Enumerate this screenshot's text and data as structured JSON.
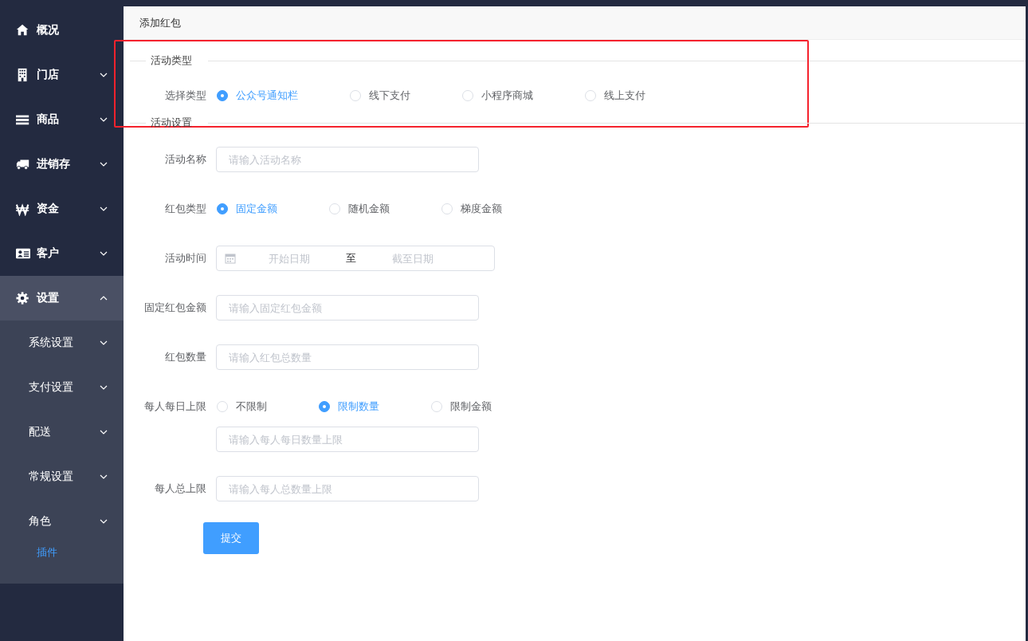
{
  "sidebar": {
    "items": [
      {
        "label": "概况",
        "selected": false
      },
      {
        "label": "门店",
        "selected": false,
        "expanded": false
      },
      {
        "label": "商品",
        "selected": false,
        "expanded": false
      },
      {
        "label": "进销存",
        "selected": false,
        "expanded": false
      },
      {
        "label": "资金",
        "selected": false,
        "expanded": false
      },
      {
        "label": "客户",
        "selected": false,
        "expanded": false
      },
      {
        "label": "设置",
        "selected": false,
        "expanded": true,
        "children": [
          {
            "label": "系统设置",
            "selected": false,
            "expanded": false
          },
          {
            "label": "支付设置",
            "selected": false,
            "expanded": false
          },
          {
            "label": "配送",
            "selected": false,
            "expanded": false
          },
          {
            "label": "常规设置",
            "selected": false,
            "expanded": false
          },
          {
            "label": "角色",
            "selected": false,
            "expanded": false
          },
          {
            "label": "插件",
            "selected": true
          }
        ]
      }
    ]
  },
  "header": {
    "title": "添加红包"
  },
  "sections": [
    {
      "legend": "活动类型",
      "highlighted": true,
      "fields": [
        {
          "kind": "radio",
          "label": "选择类型",
          "options": [
            {
              "label": "公众号通知栏",
              "selected": true
            },
            {
              "label": "线下支付",
              "selected": false
            },
            {
              "label": "小程序商城",
              "selected": false
            },
            {
              "label": "线上支付",
              "selected": false
            }
          ]
        }
      ]
    },
    {
      "legend": "活动设置",
      "fields": [
        {
          "kind": "input",
          "label": "活动名称",
          "placeholder": "请输入活动名称"
        },
        {
          "kind": "radio",
          "label": "红包类型",
          "options": [
            {
              "label": "固定金额",
              "selected": true
            },
            {
              "label": "随机金额",
              "selected": false
            },
            {
              "label": "梯度金额",
              "selected": false
            }
          ]
        },
        {
          "kind": "date_range",
          "label": "活动时间",
          "start_placeholder": "开始日期",
          "separator": "至",
          "end_placeholder": "截至日期"
        },
        {
          "kind": "input",
          "label": "固定红包金额",
          "placeholder": "请输入固定红包金额"
        },
        {
          "kind": "input",
          "label": "红包数量",
          "placeholder": "请输入红包总数量"
        },
        {
          "kind": "radio",
          "label": "每人每日上限",
          "options": [
            {
              "label": "不限制",
              "selected": false
            },
            {
              "label": "限制数量",
              "selected": true
            },
            {
              "label": "限制金额",
              "selected": false
            }
          ],
          "input": {
            "placeholder": "请输入每人每日数量上限"
          }
        },
        {
          "kind": "input",
          "label": "每人总上限",
          "placeholder": "请输入每人总数量上限"
        }
      ]
    }
  ],
  "submit": "提交"
}
